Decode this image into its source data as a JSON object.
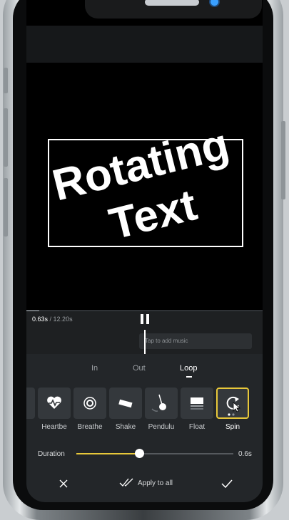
{
  "player": {
    "overlay_text_line1": "Rotating",
    "overlay_text_line2": "Text"
  },
  "timeline": {
    "current_time": "0.63s",
    "separator": " / ",
    "total_time": "12.20s",
    "music_placeholder": "Tap to add music"
  },
  "tabs": [
    {
      "label": "In"
    },
    {
      "label": "Out"
    },
    {
      "label": "Loop"
    }
  ],
  "effects": [
    {
      "label": "",
      "icon": "partial-effect-icon"
    },
    {
      "label": "Heartbe",
      "icon": "heartbeat-icon"
    },
    {
      "label": "Breathe",
      "icon": "breathe-icon"
    },
    {
      "label": "Shake",
      "icon": "shake-icon"
    },
    {
      "label": "Pendulu",
      "icon": "pendulum-icon"
    },
    {
      "label": "Float",
      "icon": "float-icon"
    },
    {
      "label": "Spin",
      "icon": "spin-icon"
    }
  ],
  "duration": {
    "label": "Duration",
    "value": "0.6s",
    "level": 0.4
  },
  "bottom": {
    "apply_all_label": "Apply to all"
  },
  "colors": {
    "accent": "#e8c83a",
    "panel": "#232629"
  }
}
